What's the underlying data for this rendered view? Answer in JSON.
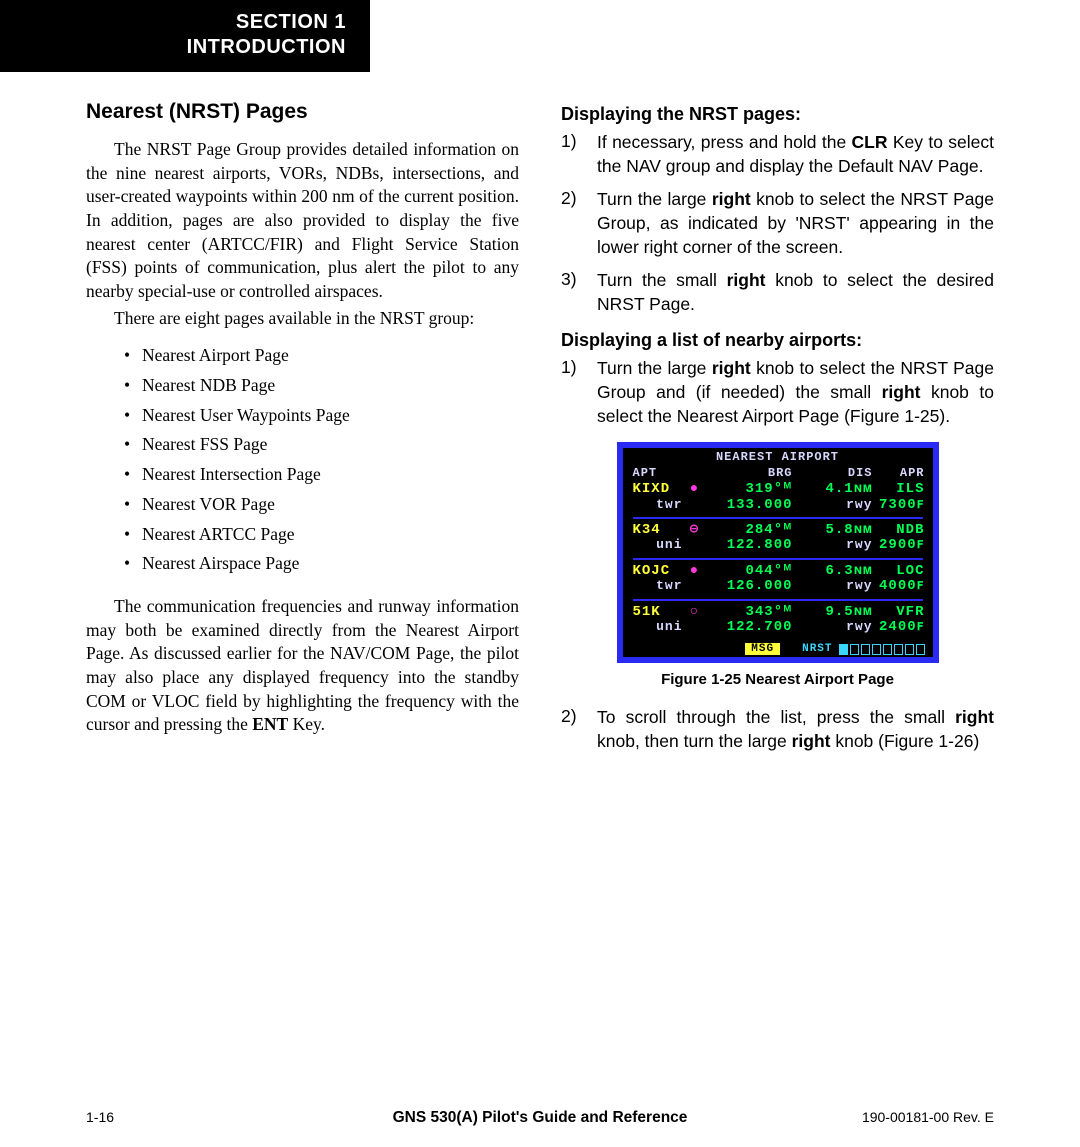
{
  "header": {
    "line1": "SECTION 1",
    "line2": "INTRODUCTION"
  },
  "left": {
    "heading": "Nearest (NRST) Pages",
    "para1": "The NRST Page Group provides detailed information on the nine nearest airports, VORs, NDBs, intersections, and user-created waypoints within 200 nm of the current position.  In addition, pages are also provided to display the five nearest center (ARTCC/FIR) and Flight Service Station (FSS) points of communication, plus alert the pilot to any nearby special-use or controlled airspaces.",
    "para2": "There are eight pages available in the NRST group:",
    "bullets": [
      "Nearest Airport Page",
      "Nearest NDB Page",
      "Nearest User Waypoints Page",
      "Nearest FSS Page",
      "Nearest Intersection Page",
      "Nearest VOR Page",
      "Nearest ARTCC Page",
      "Nearest Airspace Page"
    ],
    "para3_pre": "The communication frequencies and runway information may both be examined directly from the Nearest Airport Page.  As discussed earlier for the NAV/COM Page, the pilot may also place any displayed frequency into the standby COM or VLOC field by highlighting the frequency with the cursor and pressing the ",
    "para3_bold": "ENT",
    "para3_post": " Key."
  },
  "right": {
    "headingA": "Displaying the NRST pages:",
    "stepsA": [
      {
        "n": "1)",
        "pre": "If necessary, press and hold the ",
        "b1": "CLR",
        "mid": " Key to select the NAV group and display the Default NAV Page."
      },
      {
        "n": "2)",
        "pre": "Turn the large ",
        "b1": "right",
        "mid": " knob to select the NRST Page Group, as indicated by 'NRST' appearing in the lower right corner of the screen."
      },
      {
        "n": "3)",
        "pre": "Turn the small ",
        "b1": "right",
        "mid": " knob to select the desired NRST Page."
      }
    ],
    "headingB": "Displaying a list of nearby airports:",
    "stepsB": [
      {
        "n": "1)",
        "pre": "Turn the large ",
        "b1": "right",
        "mid": " knob to select the NRST Page Group and (if needed) the small ",
        "b2": "right",
        "post": " knob to select the Nearest Airport Page (Figure 1-25)."
      }
    ],
    "device": {
      "title": "NEAREST AIRPORT",
      "headers": {
        "c1": "APT",
        "c2": "BRG",
        "c3": "DIS",
        "c4": "APR"
      },
      "rows": [
        {
          "id": "KIXD",
          "brg": "319°ᴹ",
          "dis": "4.1ɴᴍ",
          "apr": "ILS",
          "sub_label": "twr",
          "freq": "133.000",
          "rwy_label": "rwy",
          "rwy": "7300ꜰ"
        },
        {
          "id": "K34",
          "brg": "284°ᴹ",
          "dis": "5.8ɴᴍ",
          "apr": "NDB",
          "sub_label": "uni",
          "freq": "122.800",
          "rwy_label": "rwy",
          "rwy": "2900ꜰ"
        },
        {
          "id": "KOJC",
          "brg": "044°ᴹ",
          "dis": "6.3ɴᴍ",
          "apr": "LOC",
          "sub_label": "twr",
          "freq": "126.000",
          "rwy_label": "rwy",
          "rwy": "4000ꜰ"
        },
        {
          "id": "51K",
          "brg": "343°ᴹ",
          "dis": "9.5ɴᴍ",
          "apr": "VFR",
          "sub_label": "uni",
          "freq": "122.700",
          "rwy_label": "rwy",
          "rwy": "2400ꜰ"
        }
      ],
      "footer": {
        "msg": "MSG",
        "group": "NRST"
      }
    },
    "caption": "Figure 1-25  Nearest Airport Page",
    "stepsC": [
      {
        "n": "2)",
        "pre": "To scroll through the list, press the small ",
        "b1": "right",
        "mid": " knob, then turn the large ",
        "b2": "right",
        "post": " knob (Figure 1-26)"
      }
    ]
  },
  "footer": {
    "left": "1-16",
    "center": "GNS 530(A) Pilot's Guide and Reference",
    "right": "190-00181-00  Rev. E"
  }
}
